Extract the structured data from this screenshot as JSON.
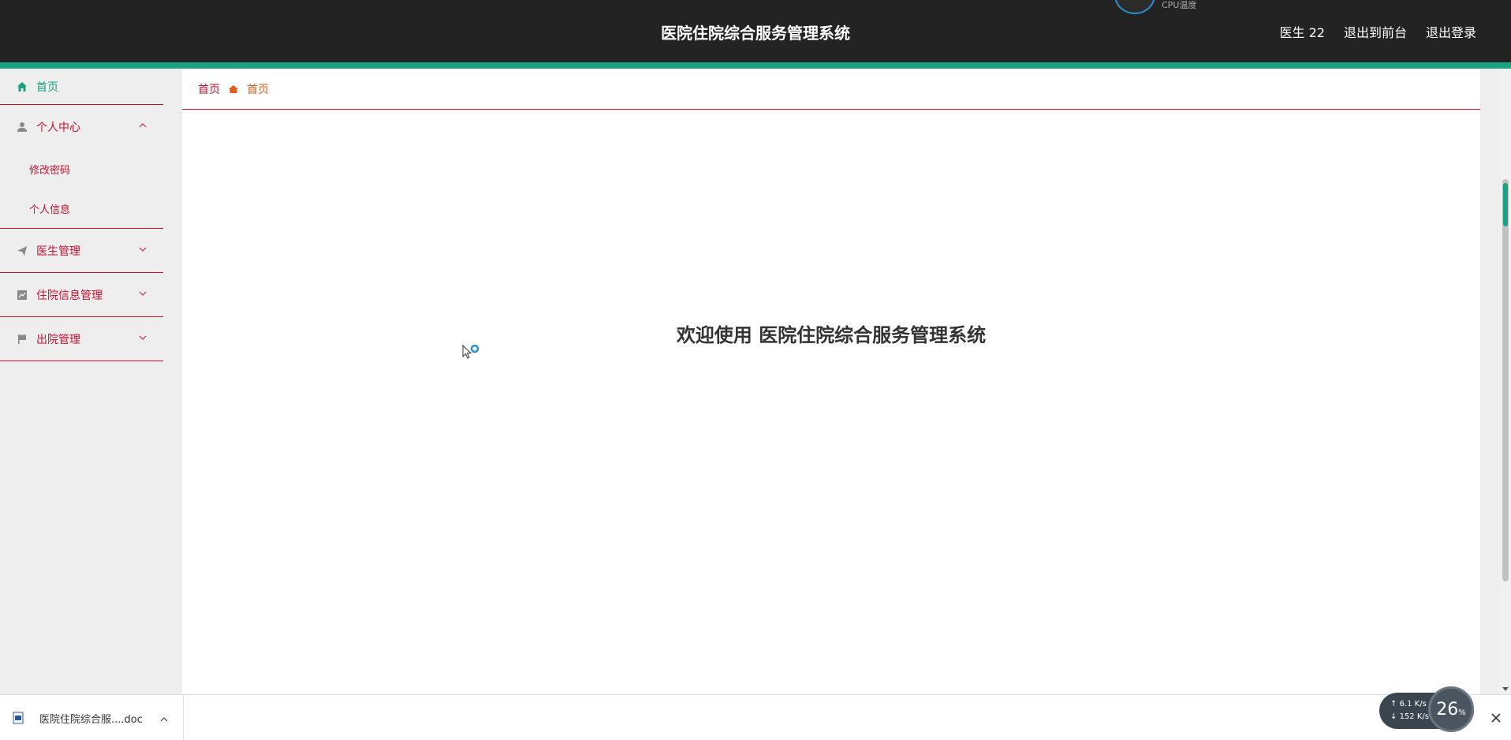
{
  "header": {
    "title": "医院住院综合服务管理系统",
    "user": "医生 22",
    "back_to_front": "退出到前台",
    "logout": "退出登录",
    "cpu_label": "CPU温度",
    "accent_color": "#1aa083"
  },
  "sidebar": {
    "items": [
      {
        "label": "首页",
        "icon": "home-icon"
      },
      {
        "label": "个人中心",
        "icon": "user-icon",
        "expanded": true,
        "children": [
          {
            "label": "修改密码"
          },
          {
            "label": "个人信息"
          }
        ]
      },
      {
        "label": "医生管理",
        "icon": "send-icon"
      },
      {
        "label": "住院信息管理",
        "icon": "chart-icon"
      },
      {
        "label": "出院管理",
        "icon": "flag-icon"
      }
    ]
  },
  "breadcrumb": {
    "first": "首页",
    "second": "首页"
  },
  "main": {
    "welcome": "欢迎使用 医院住院综合服务管理系统"
  },
  "downloads": {
    "file_name": "医院住院综合服....doc"
  },
  "net_monitor": {
    "upload": "6.1",
    "upload_unit": "K/s",
    "download": "152",
    "download_unit": "K/s",
    "percent": "26",
    "percent_unit": "%"
  }
}
